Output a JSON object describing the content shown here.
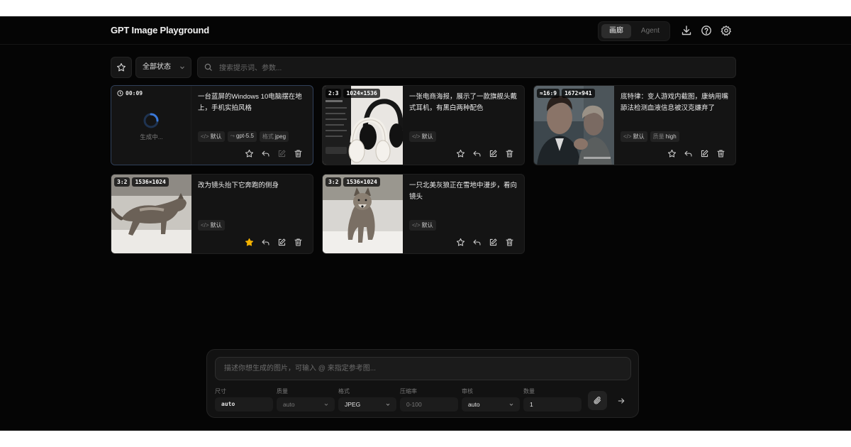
{
  "app": {
    "title": "GPT Image Playground"
  },
  "header": {
    "tabs": [
      {
        "label": "画廊",
        "active": true
      },
      {
        "label": "Agent",
        "active": false
      }
    ],
    "icons": [
      "download-icon",
      "help-icon",
      "settings-icon"
    ]
  },
  "toolbar": {
    "status_filter": "全部状态",
    "search_placeholder": "搜索提示词、参数..."
  },
  "cards": [
    {
      "state": "generating",
      "timer": "00:09",
      "generating_label": "生成中...",
      "prompt": "一台蓝屏的Windows 10电脑摆在地上，手机实拍风格",
      "tags": [
        {
          "key": "</>",
          "value": "默认"
        },
        {
          "key": "⤳",
          "value": "gpt-5.5"
        },
        {
          "key": "格式",
          "value": "jpeg"
        }
      ],
      "favorited": false
    },
    {
      "state": "done",
      "ratio": "2:3",
      "size": "1024×1536",
      "prompt": "一张电商海报，展示了一款旗舰头戴式耳机，有黑白两种配色",
      "tags": [
        {
          "key": "</>",
          "value": "默认"
        }
      ],
      "favorited": false
    },
    {
      "state": "done",
      "ratio": "≈16:9",
      "size": "1672×941",
      "prompt": "底特律：变人游戏内截图，康纳用嘴舔法检测血液信息被汉克嫌弃了",
      "tags": [
        {
          "key": "</>",
          "value": "默认"
        },
        {
          "key": "质量",
          "value": "high"
        }
      ],
      "favorited": false
    },
    {
      "state": "done",
      "ratio": "3:2",
      "size": "1536×1024",
      "prompt": "改为镜头抬下它奔跑的侧身",
      "tags": [
        {
          "key": "</>",
          "value": "默认"
        }
      ],
      "favorited": true
    },
    {
      "state": "done",
      "ratio": "3:2",
      "size": "1536×1024",
      "prompt": "一只北美灰狼正在雪地中漫步，看向镜头",
      "tags": [
        {
          "key": "</>",
          "value": "默认"
        }
      ],
      "favorited": false
    }
  ],
  "composer": {
    "placeholder": "描述你想生成的图片，可输入 @ 来指定参考图...",
    "params": [
      {
        "label": "尺寸",
        "value": "auto",
        "dropdown": false,
        "dim": false,
        "mono": true
      },
      {
        "label": "质量",
        "value": "auto",
        "dropdown": true,
        "dim": true,
        "mono": false
      },
      {
        "label": "格式",
        "value": "JPEG",
        "dropdown": true,
        "dim": false,
        "mono": false
      },
      {
        "label": "压缩率",
        "value": "0-100",
        "dropdown": false,
        "dim": true,
        "mono": false
      },
      {
        "label": "审核",
        "value": "auto",
        "dropdown": true,
        "dim": false,
        "mono": false
      },
      {
        "label": "数量",
        "value": "1",
        "dropdown": false,
        "dim": false,
        "mono": false
      }
    ]
  },
  "colors": {
    "background": "#050505",
    "card": "#141414",
    "favorite": "#f5b301",
    "spinner": "#3a78d8"
  }
}
